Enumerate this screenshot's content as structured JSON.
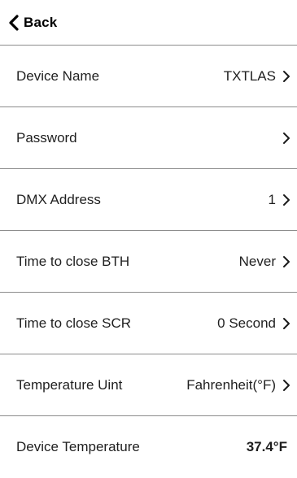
{
  "nav": {
    "back_label": "Back",
    "back_icon": "chevron-left-icon"
  },
  "rows": [
    {
      "label": "Device Name",
      "value": "TXTLAS",
      "icon": "chevron-right-icon"
    },
    {
      "label": "Password",
      "value": "",
      "icon": "chevron-right-icon"
    },
    {
      "label": "DMX Address",
      "value": "1",
      "icon": "chevron-right-icon"
    },
    {
      "label": "Time to close BTH",
      "value": "Never",
      "icon": "chevron-right-icon"
    },
    {
      "label": "Time to close SCR",
      "value": "0 Second",
      "icon": "chevron-right-icon"
    },
    {
      "label": "Temperature Uint",
      "value": "Fahrenheit(°F)",
      "icon": "chevron-right-icon"
    },
    {
      "label": "Device Temperature",
      "value": "37.4°F"
    }
  ],
  "colors": {
    "text": "#1f1f1f",
    "divider": "#8c8c8c",
    "background": "#ffffff"
  }
}
